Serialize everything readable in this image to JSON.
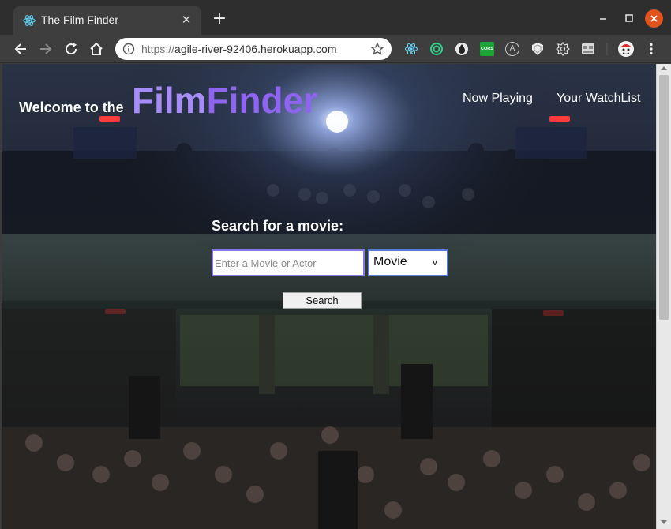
{
  "browser": {
    "tab_title": "The Film Finder",
    "tab_close": "✕",
    "new_tab": "+",
    "url_scheme": "https://",
    "url_host": "agile-river-92406.herokuapp.com",
    "extensions": [
      "react-devtools-icon",
      "circle-extension-icon",
      "dark-drop-icon",
      "cors-icon",
      "a-circle-icon",
      "shield-icon",
      "gear-icon",
      "grid-icon",
      "avatar-extension-icon"
    ],
    "cors_label": "CORS",
    "a_label": "A"
  },
  "page": {
    "welcome_text": "Welcome to the",
    "logo_part1": "Film",
    "logo_part2": "Finder",
    "nav": [
      {
        "label": "Now Playing"
      },
      {
        "label": "Your WatchList"
      }
    ],
    "search_heading": "Search for a movie:",
    "search_placeholder": "Enter a Movie or Actor",
    "search_value": "",
    "select_value": "Movie",
    "select_arrow": "v",
    "search_button": "Search"
  },
  "colors": {
    "logo_light": "#a58cf6",
    "logo_dark": "#8e64f0",
    "close_button": "#e0541e"
  }
}
